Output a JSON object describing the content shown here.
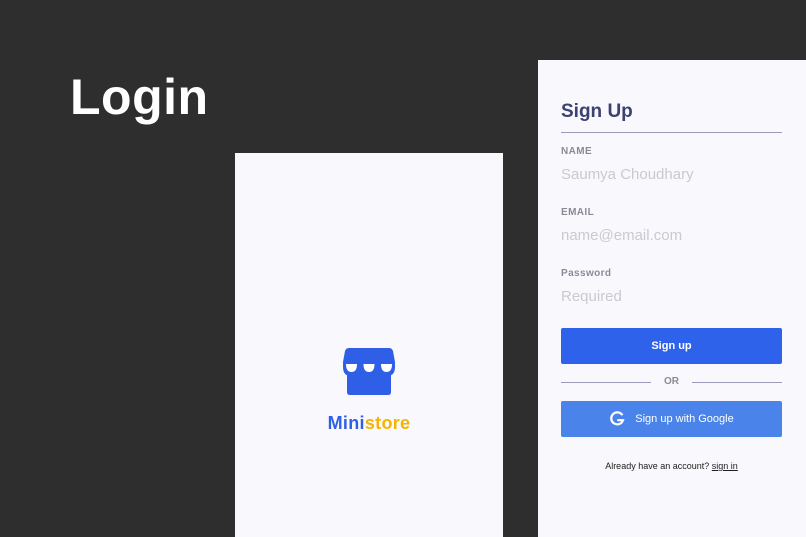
{
  "page": {
    "heading": "Login"
  },
  "splash": {
    "brand_part1": "Mini",
    "brand_part2": "store",
    "logo_icon": "storefront-icon",
    "colors": {
      "brand_blue": "#2f5fe6",
      "brand_yellow": "#f4b400",
      "card_bg": "#f9f9fd"
    }
  },
  "signup": {
    "title": "Sign Up",
    "fields": {
      "name": {
        "label": "NAME",
        "value": "",
        "placeholder": "Saumya Choudhary"
      },
      "email": {
        "label": "EMAIL",
        "value": "",
        "placeholder": "name@email.com"
      },
      "password": {
        "label": "Password",
        "value": "",
        "placeholder": "Required"
      }
    },
    "submit_label": "Sign up",
    "or_label": "OR",
    "google_label": "Sign up with Google",
    "google_icon": "google-g-icon",
    "signin_prompt": "Already have an account?",
    "signin_link": "sign in",
    "colors": {
      "primary": "#2f62ea",
      "google": "#4a83ea",
      "title": "#3c4270"
    }
  }
}
